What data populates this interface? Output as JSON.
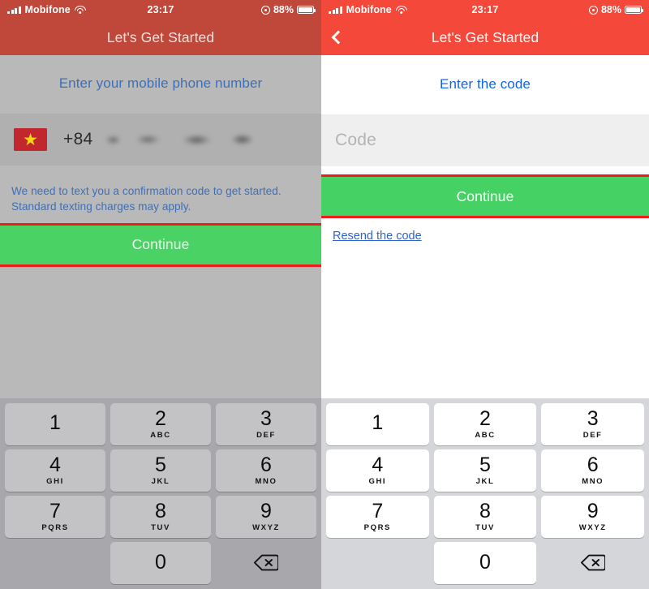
{
  "colors": {
    "header_red": "#f4493a",
    "header_red_dim": "#c0483a",
    "continue_green": "#45d164",
    "annotation_red": "#ee1c1c",
    "link_blue": "#1463e8",
    "hint_blue": "#3f6fb5",
    "keypad_bg": "#d5d6da",
    "keypad_bg_dim": "#a8a8ac",
    "field_gray": "#efefef",
    "flag_red": "#c1272d",
    "flag_star_yellow": "#f5d316"
  },
  "status_bar": {
    "carrier": "Mobifone",
    "time": "23:17",
    "battery_percent": "88%",
    "signal_icon": "signal-bars-icon",
    "wifi_icon": "wifi-icon",
    "location_icon": "location-services-icon",
    "battery_icon": "battery-icon"
  },
  "left_screen": {
    "nav_title": "Let's Get Started",
    "prompt": "Enter your mobile phone number",
    "country_flag": "vietnam-flag-icon",
    "country_code": "+84",
    "phone_number_value": "",
    "phone_number_redacted": true,
    "hint": "We need to text you a confirmation code to get started. Standard texting charges may apply.",
    "continue_label": "Continue",
    "annotated": true
  },
  "right_screen": {
    "nav_title": "Let's Get Started",
    "back_icon": "chevron-left-icon",
    "prompt": "Enter the code",
    "code_value": "",
    "code_placeholder": "Code",
    "continue_label": "Continue",
    "resend_label": "Resend the code",
    "annotated": true
  },
  "keypad": {
    "delete_icon": "backspace-icon",
    "rows": [
      [
        {
          "num": "1",
          "sub": ""
        },
        {
          "num": "2",
          "sub": "ABC"
        },
        {
          "num": "3",
          "sub": "DEF"
        }
      ],
      [
        {
          "num": "4",
          "sub": "GHI"
        },
        {
          "num": "5",
          "sub": "JKL"
        },
        {
          "num": "6",
          "sub": "MNO"
        }
      ],
      [
        {
          "num": "7",
          "sub": "PQRS"
        },
        {
          "num": "8",
          "sub": "TUV"
        },
        {
          "num": "9",
          "sub": "WXYZ"
        }
      ],
      [
        {
          "num": "",
          "sub": "",
          "blank": true
        },
        {
          "num": "0",
          "sub": ""
        },
        {
          "num": "",
          "sub": "",
          "delete": true
        }
      ]
    ]
  }
}
